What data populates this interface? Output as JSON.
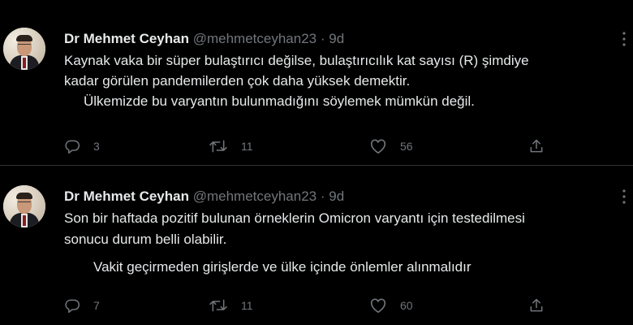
{
  "tweets": [
    {
      "author": {
        "name": "Dr Mehmet Ceyhan",
        "handle": "@mehmetceyhan23",
        "separator": "·",
        "time": "9d"
      },
      "text_lines": [
        "Kaynak vaka bir süper bulaştırıcı değilse, bulaştırıcılık kat sayısı (R) şimdiye",
        "kadar görülen pandemilerden çok daha yüksek demektir.",
        "Ülkemizde bu varyantın bulunmadığını söylemek mümkün değil."
      ],
      "stats": {
        "replies": "3",
        "retweets": "11",
        "likes": "56"
      }
    },
    {
      "author": {
        "name": "Dr Mehmet Ceyhan",
        "handle": "@mehmetceyhan23",
        "separator": "·",
        "time": "9d"
      },
      "text_lines": [
        "Son bir haftada pozitif bulunan örneklerin Omicron varyantı için testedilmesi",
        "sonucu durum belli olabilir.",
        "Vakit geçirmeden girişlerde ve ülke içinde önlemler alınmalıdır"
      ],
      "stats": {
        "replies": "7",
        "retweets": "11",
        "likes": "60"
      }
    }
  ],
  "icons": {
    "reply": "reply-icon",
    "retweet": "retweet-icon",
    "like": "heart-icon",
    "share": "share-icon",
    "more": "more-icon"
  },
  "colors": {
    "background": "#000000",
    "text_primary": "#e7e9ea",
    "text_secondary": "#71767b",
    "divider": "#2f3336"
  }
}
